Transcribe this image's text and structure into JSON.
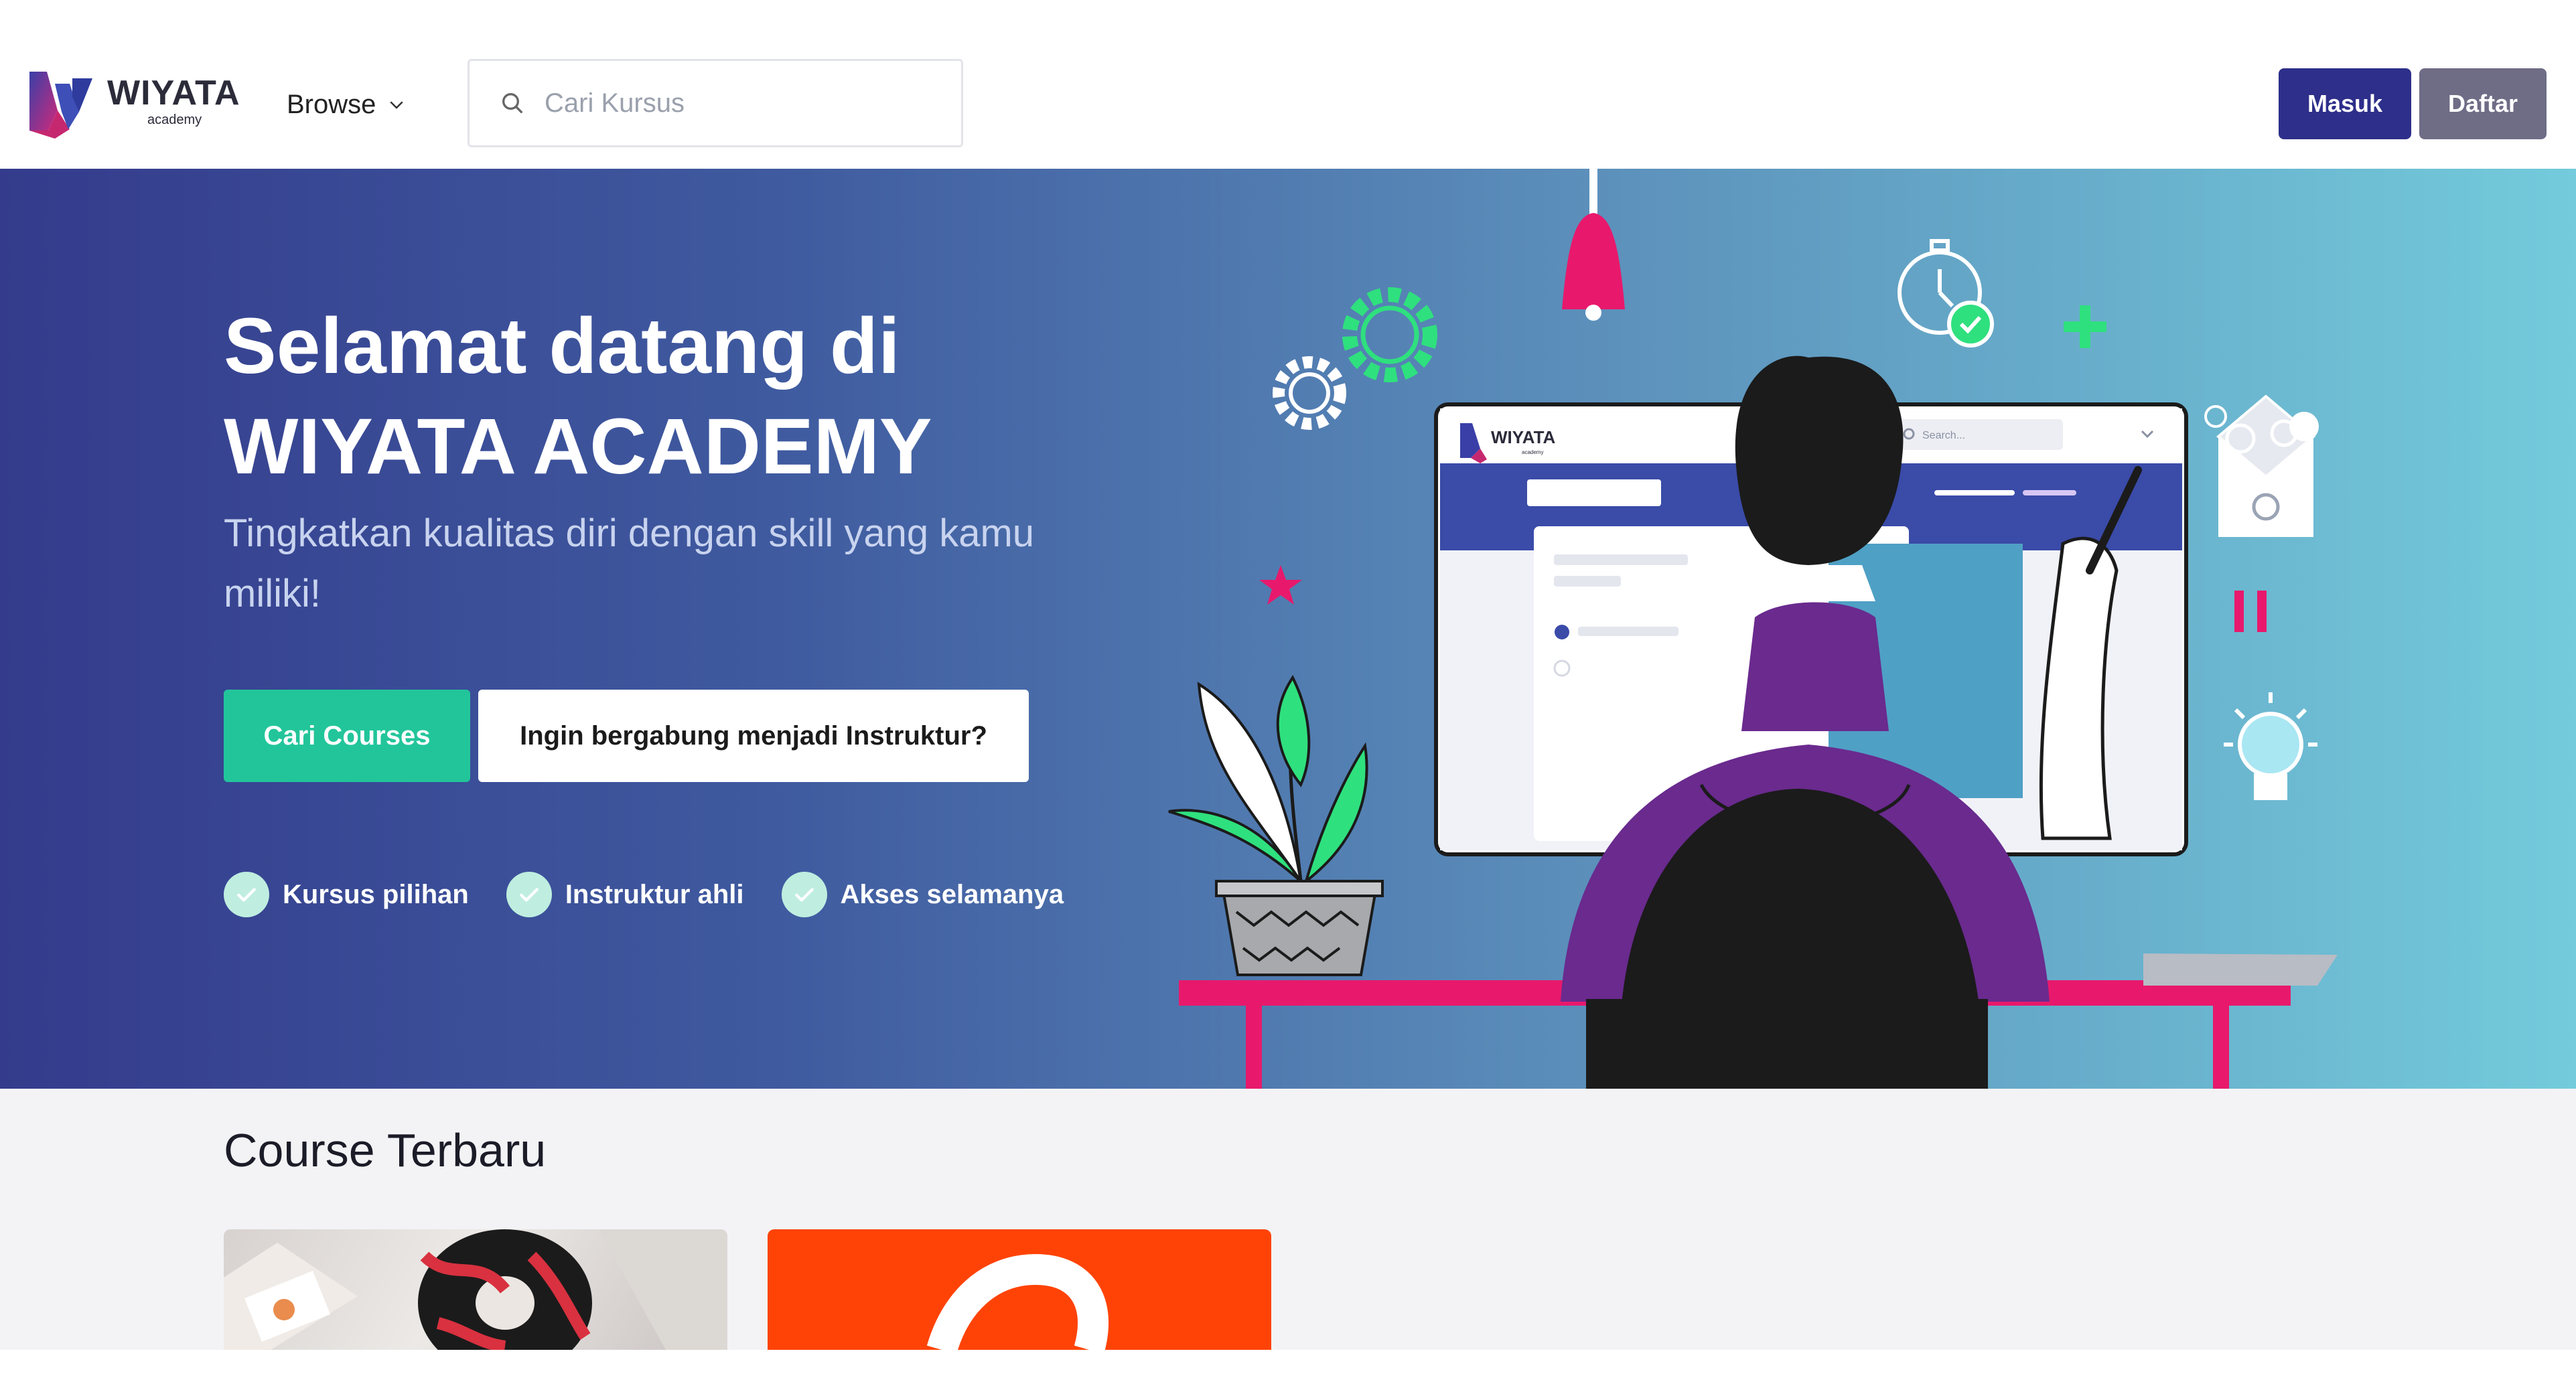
{
  "brand": {
    "name": "WIYATA",
    "sub": "academy"
  },
  "nav": {
    "browse_label": "Browse",
    "search_placeholder": "Cari Kursus",
    "login_label": "Masuk",
    "register_label": "Daftar"
  },
  "hero": {
    "title_line1": "Selamat datang di",
    "title_line2": "WIYATA ACADEMY",
    "subtitle": "Tingkatkan kualitas diri dengan skill yang kamu miliki!",
    "primary_button": "Cari Courses",
    "secondary_button": "Ingin bergabung menjadi Instruktur?",
    "features": [
      {
        "label": "Kursus pilihan"
      },
      {
        "label": "Instruktur ahli"
      },
      {
        "label": "Akses selamanya"
      }
    ],
    "illustration_screen": {
      "brand": "WIYATA",
      "brand_sub": "academy",
      "search_placeholder": "Search..."
    }
  },
  "courses": {
    "title": "Course Terbaru"
  },
  "colors": {
    "primary": "#2e2f8a",
    "secondary_button": "#6f6c86",
    "accent_green": "#22c59a",
    "hero_gradient_start": "#343b8c",
    "hero_gradient_end": "#73cbdb"
  }
}
